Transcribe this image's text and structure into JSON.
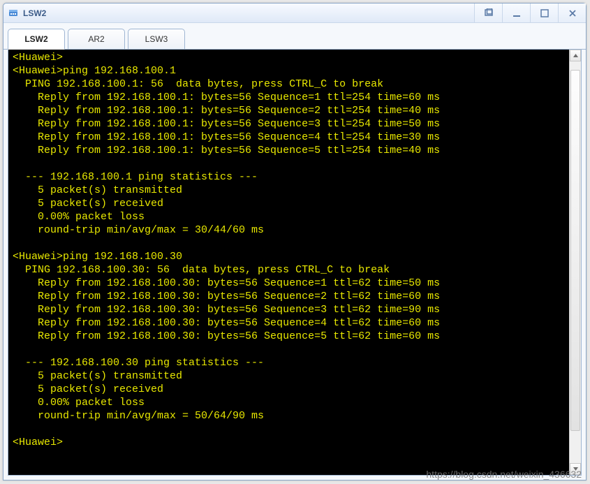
{
  "window": {
    "title": "LSW2"
  },
  "tabs": [
    {
      "label": "LSW2",
      "active": true
    },
    {
      "label": "AR2",
      "active": false
    },
    {
      "label": "LSW3",
      "active": false
    }
  ],
  "terminal": {
    "prompt": "<Huawei>",
    "sessions": [
      {
        "command": "ping 192.168.100.1",
        "header": "  PING 192.168.100.1: 56  data bytes, press CTRL_C to break",
        "replies": [
          "    Reply from 192.168.100.1: bytes=56 Sequence=1 ttl=254 time=60 ms",
          "    Reply from 192.168.100.1: bytes=56 Sequence=2 ttl=254 time=40 ms",
          "    Reply from 192.168.100.1: bytes=56 Sequence=3 ttl=254 time=50 ms",
          "    Reply from 192.168.100.1: bytes=56 Sequence=4 ttl=254 time=30 ms",
          "    Reply from 192.168.100.1: bytes=56 Sequence=5 ttl=254 time=40 ms"
        ],
        "stats_header": "  --- 192.168.100.1 ping statistics ---",
        "stats": [
          "    5 packet(s) transmitted",
          "    5 packet(s) received",
          "    0.00% packet loss",
          "    round-trip min/avg/max = 30/44/60 ms"
        ]
      },
      {
        "command": "ping 192.168.100.30",
        "header": "  PING 192.168.100.30: 56  data bytes, press CTRL_C to break",
        "replies": [
          "    Reply from 192.168.100.30: bytes=56 Sequence=1 ttl=62 time=50 ms",
          "    Reply from 192.168.100.30: bytes=56 Sequence=2 ttl=62 time=60 ms",
          "    Reply from 192.168.100.30: bytes=56 Sequence=3 ttl=62 time=90 ms",
          "    Reply from 192.168.100.30: bytes=56 Sequence=4 ttl=62 time=60 ms",
          "    Reply from 192.168.100.30: bytes=56 Sequence=5 ttl=62 time=60 ms"
        ],
        "stats_header": "  --- 192.168.100.30 ping statistics ---",
        "stats": [
          "    5 packet(s) transmitted",
          "    5 packet(s) received",
          "    0.00% packet loss",
          "    round-trip min/avg/max = 50/64/90 ms"
        ]
      }
    ]
  },
  "scrollbar": {
    "thumb_top_pct": 2,
    "thumb_height_pct": 90
  },
  "watermark": "https://blog.csdn.net/weixin_436632"
}
